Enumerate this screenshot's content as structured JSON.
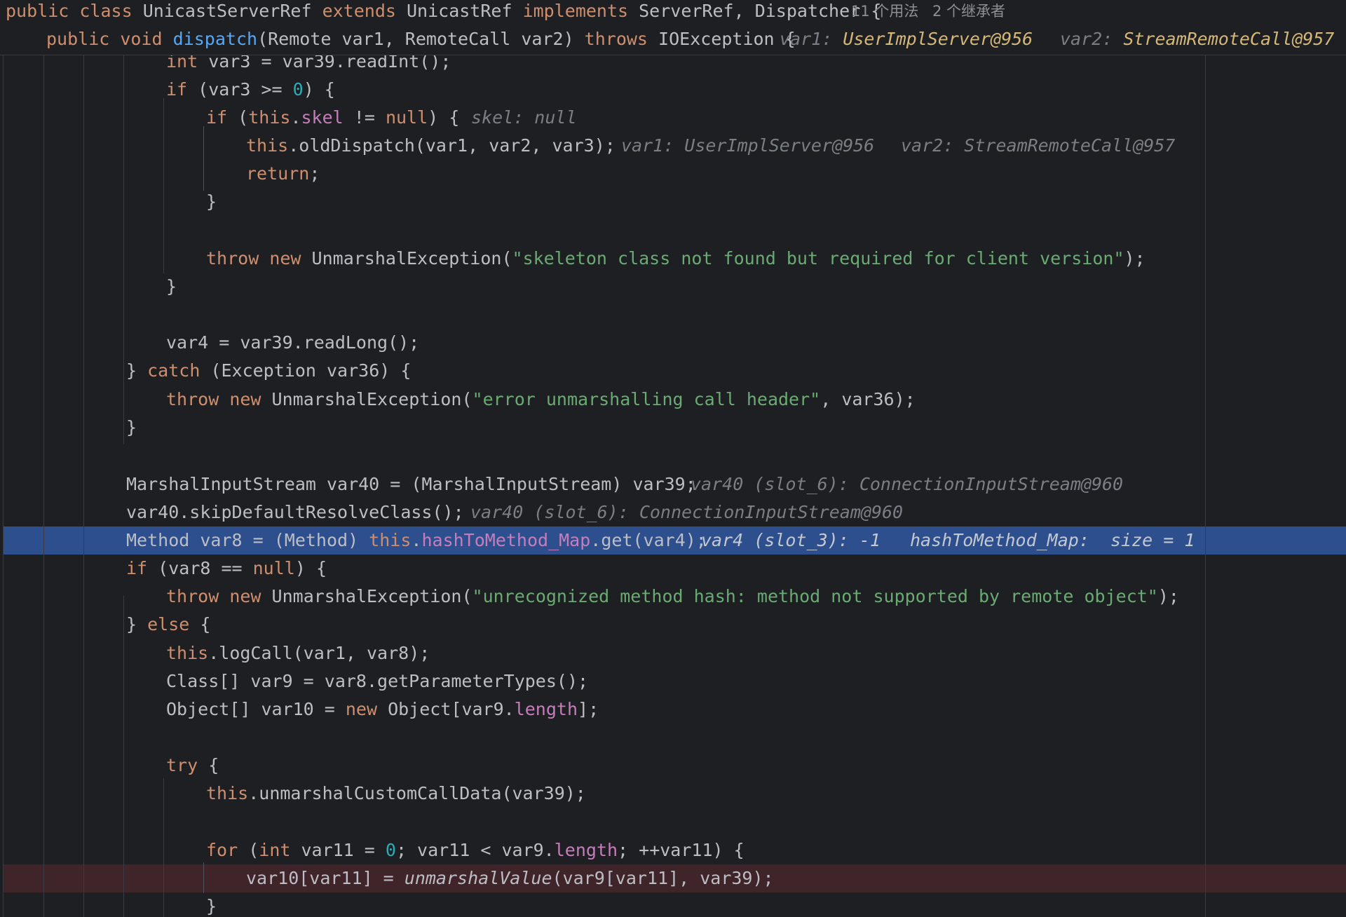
{
  "sticky": {
    "class_decl": {
      "t1": "public",
      "t2": " ",
      "t3": "class",
      "t4": " UnicastServerRef ",
      "t5": "extends",
      "t6": " UnicastRef ",
      "t7": "implements",
      "t8": " ServerRef, Dispatcher {",
      "usages": "11 个用法",
      "inheritors": "2 个继承者"
    },
    "method_decl": {
      "t1": "public",
      "t2": " ",
      "t3": "void",
      "t4": " ",
      "name": "dispatch",
      "t5": "(Remote var1, RemoteCall var2) ",
      "t6": "throws",
      "t7": " IOException {",
      "hint1_label": "var1: ",
      "hint1_value": "UserImplServer@956",
      "hint2_label": "var2: ",
      "hint2_value": "StreamRemoteCall@957"
    }
  },
  "lines": {
    "l1": {
      "a": "int",
      "b": " var3 = var39.readInt();"
    },
    "l2": {
      "a": "if",
      "b": " (var3 >= ",
      "c": "0",
      "d": ") {"
    },
    "l3": {
      "a": "if",
      "b": " (",
      "c": "this",
      "d": ".",
      "e": "skel",
      "f": " != ",
      "g": "null",
      "h": ") {",
      "hint": "skel: null"
    },
    "l4": {
      "a": "this",
      "b": ".oldDispatch(var1, var2, var3);",
      "hint1": "var1: UserImplServer@956",
      "hint2": "var2: StreamRemoteCall@957"
    },
    "l5": {
      "a": "return",
      "b": ";"
    },
    "l6": {
      "a": "}"
    },
    "l7": {
      "a": "throw",
      "b": " ",
      "c": "new",
      "d": " UnmarshalException(",
      "e": "\"skeleton class not found but required for client version\"",
      "f": ");"
    },
    "l8": {
      "a": "}"
    },
    "l9": {
      "a": "var4 = var39.readLong();"
    },
    "l10": {
      "a": "} ",
      "b": "catch",
      "c": " (Exception var36) {"
    },
    "l11": {
      "a": "throw",
      "b": " ",
      "c": "new",
      "d": " UnmarshalException(",
      "e": "\"error unmarshalling call header\"",
      "f": ", var36);"
    },
    "l12": {
      "a": "}"
    },
    "l13": {
      "a": "MarshalInputStream var40 = (MarshalInputStream) var39;",
      "hint": "var40 (slot_6): ConnectionInputStream@960"
    },
    "l14": {
      "a": "var40.skipDefaultResolveClass();",
      "hint": "var40 (slot_6): ConnectionInputStream@960"
    },
    "l15": {
      "a": "Method var8 = (Method) ",
      "b": "this",
      "c": ".",
      "d": "hashToMethod_Map",
      "e": ".get(var4);",
      "hint1": "var4 (slot_3): -1",
      "hint2": "hashToMethod_Map:  size = 1"
    },
    "l16": {
      "a": "if",
      "b": " (var8 == ",
      "c": "null",
      "d": ") {"
    },
    "l17": {
      "a": "throw",
      "b": " ",
      "c": "new",
      "d": " UnmarshalException(",
      "e": "\"unrecognized method hash: method not supported by remote object\"",
      "f": ");"
    },
    "l18": {
      "a": "} ",
      "b": "else",
      "c": " {"
    },
    "l19": {
      "a": "this",
      "b": ".logCall(var1, var8);"
    },
    "l20": {
      "a": "Class[] var9 = var8.getParameterTypes();"
    },
    "l21": {
      "a": "Object[] var10 = ",
      "b": "new",
      "c": " Object[var9.",
      "d": "length",
      "e": "];"
    },
    "l22": {
      "a": "try",
      "b": " {"
    },
    "l23": {
      "a": "this",
      "b": ".unmarshalCustomCallData(var39);"
    },
    "l24": {
      "a": "for",
      "b": " (",
      "c": "int",
      "d": " var11 = ",
      "e": "0",
      "f": "; var11 < var9.",
      "g": "length",
      "h": "; ++var11) {"
    },
    "l25": {
      "a": "var10[var11] = ",
      "b": "unmarshalValue",
      "c": "(var9[var11], var39);"
    },
    "l26": {
      "a": "}"
    }
  }
}
